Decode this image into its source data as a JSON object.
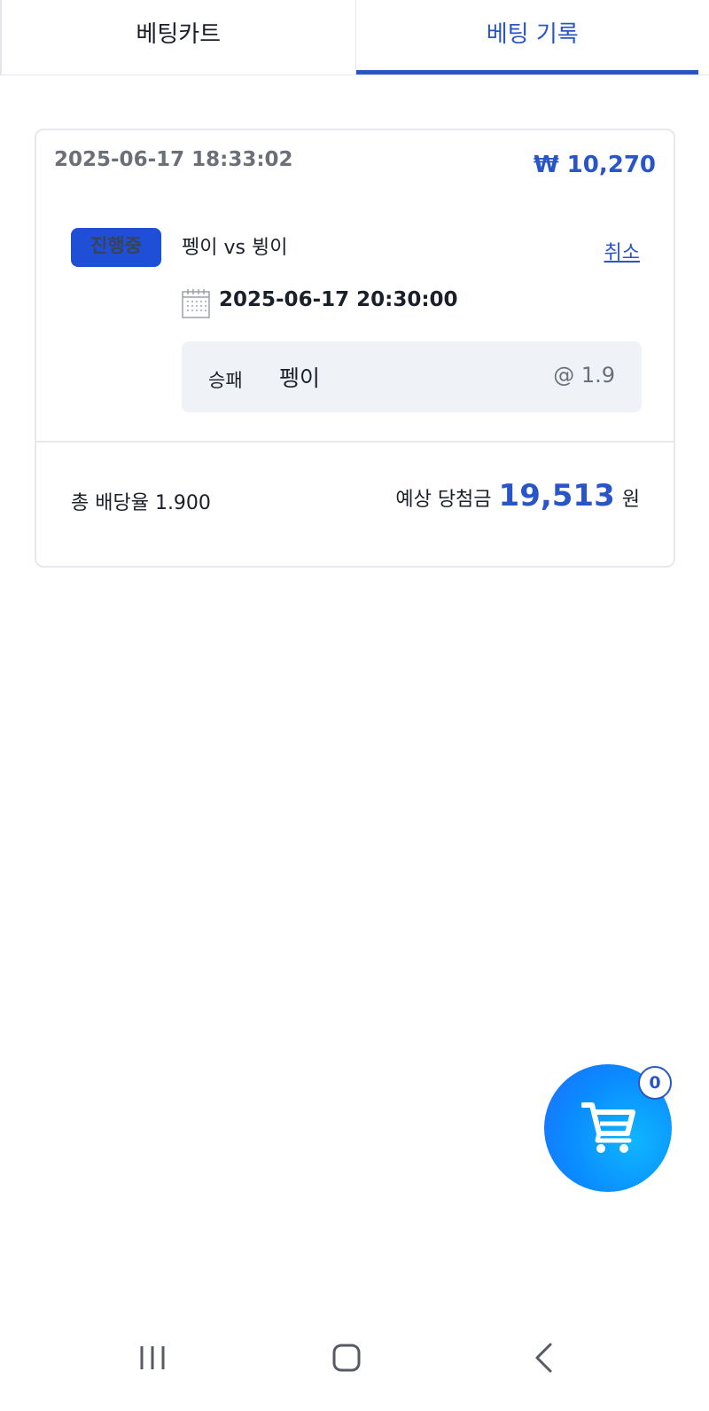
{
  "tabs": [
    {
      "label": "베팅카트",
      "active": false
    },
    {
      "label": "베팅 기록",
      "active": true
    }
  ],
  "bet": {
    "placed_at": "2025-06-17 18:33:02",
    "stake": "₩ 10,270",
    "status": "진행중",
    "match": "펭이 vs 뷩이",
    "cancel_label": "취소",
    "match_time": "2025-06-17 20:30:00",
    "market": "승패",
    "selection": "펭이",
    "odds": "@ 1.9",
    "total_odds_label": "총 배당율 1.900",
    "payout_label": "예상 당첨금",
    "payout_value": "19,513",
    "payout_unit": "원"
  },
  "cart": {
    "count": "0",
    "icon": "cart-icon"
  },
  "colors": {
    "accent": "#2a55c8",
    "badge": "#1f4fd6",
    "fab": "#0a8cff",
    "pick_bg": "#eff3f8"
  }
}
